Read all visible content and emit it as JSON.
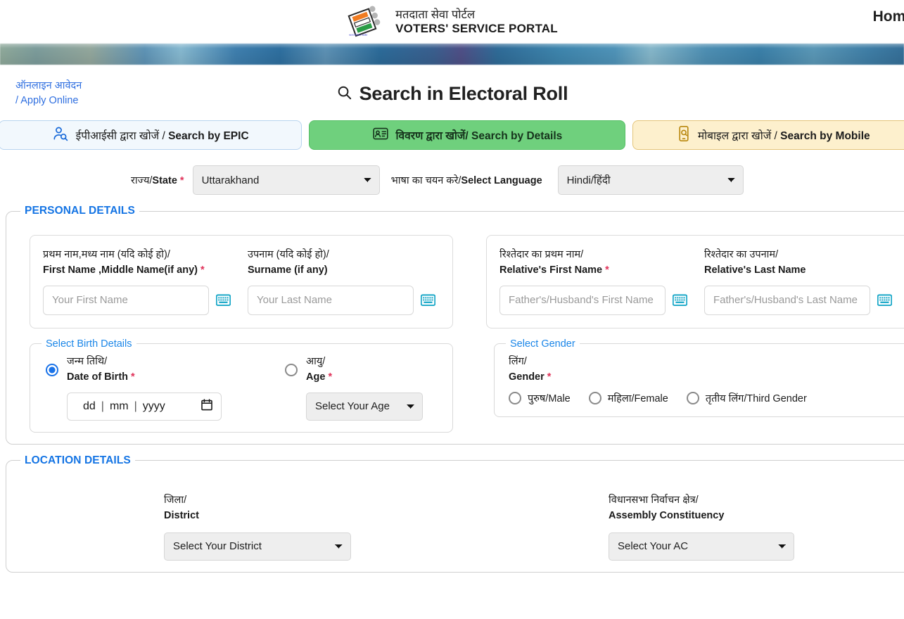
{
  "header": {
    "brand_hi": "मतदाता सेवा पोर्टल",
    "brand_en": "VOTERS' SERVICE PORTAL",
    "logo_icon": "eci-evm-logo-icon",
    "nav_home": "Home"
  },
  "apply_online": {
    "line1": "ऑनलाइन आवेदन",
    "line2": "/ Apply Online"
  },
  "page": {
    "title": "Search in Electoral Roll",
    "title_icon": "search-icon"
  },
  "tabs": [
    {
      "key": "epic",
      "icon": "person-search-icon",
      "hi": "ईपीआईसी द्वारा खोजें",
      "sep": " / ",
      "en": "Search by EPIC",
      "active": false
    },
    {
      "key": "details",
      "icon": "id-card-icon",
      "hi": "विवरण द्वारा खोजें",
      "sep": "/ ",
      "en": "Search by Details",
      "active": true
    },
    {
      "key": "mobile",
      "icon": "mobile-search-icon",
      "hi": "मोबाइल द्वारा खोजें",
      "sep": " / ",
      "en": "Search by Mobile",
      "active": false
    }
  ],
  "top_selects": {
    "state": {
      "label_hi": "राज्य/",
      "label_en": "State",
      "required": "*",
      "value": "Uttarakhand"
    },
    "language": {
      "label_hi": "भाषा का चयन करे/",
      "label_en": "Select Language",
      "value": "Hindi/हिंदी"
    }
  },
  "personal_details": {
    "legend": "PERSONAL DETAILS",
    "first_name": {
      "label_hi": "प्रथम नाम,मध्य नाम (यदि कोई हो)/",
      "label_en": "First Name ,Middle Name(if any)",
      "required": "*",
      "placeholder": "Your First Name",
      "value": ""
    },
    "surname": {
      "label_hi": "उपनाम (यदि कोई हो)/",
      "label_en": "Surname (if any)",
      "required": "",
      "placeholder": "Your Last Name",
      "value": ""
    },
    "relative_first_name": {
      "label_hi": "रिश्तेदार का प्रथम नाम/",
      "label_en": "Relative's First Name",
      "required": "*",
      "placeholder": "Father's/Husband's First Name",
      "value": ""
    },
    "relative_last_name": {
      "label_hi": "रिश्तेदार का उपनाम/",
      "label_en": "Relative's Last Name",
      "required": "",
      "placeholder": "Father's/Husband's Last Name",
      "value": ""
    },
    "birth": {
      "legend": "Select Birth Details",
      "dob": {
        "label_hi": "जन्म तिथि/",
        "label_en": "Date of Birth",
        "required": "*",
        "selected": true,
        "day_placeholder": "dd",
        "month_placeholder": "mm",
        "year_placeholder": "yyyy",
        "value": "",
        "calendar_icon": "calendar-icon"
      },
      "age": {
        "label_hi": "आयु/",
        "label_en": "Age",
        "required": "*",
        "selected": false,
        "value": "Select Your Age"
      }
    },
    "gender": {
      "legend": "Select Gender",
      "label_hi": "लिंग/",
      "label_en": "Gender",
      "required": "*",
      "options": [
        {
          "label": "पुरुष/Male",
          "selected": false
        },
        {
          "label": "महिला/Female",
          "selected": false
        },
        {
          "label": "तृतीय लिंग/Third Gender",
          "selected": false
        }
      ]
    },
    "keyboard_icon": "virtual-keyboard-icon"
  },
  "location_details": {
    "legend": "LOCATION DETAILS",
    "district": {
      "label_hi": "जिला/",
      "label_en": "District",
      "value": "Select Your District"
    },
    "assembly_constituency": {
      "label_hi": "विधानसभा निर्वाचन क्षेत्र/",
      "label_en": "Assembly Constituency",
      "value": "Select Your AC"
    }
  },
  "colors": {
    "accent_blue": "#1474e4",
    "tab_green": "#6fd07d",
    "tab_yellow": "#fdf0cd",
    "tab_blue": "#f2f8fd",
    "required_red": "#e0335a",
    "keyboard_icon": "#1aa8c8"
  }
}
